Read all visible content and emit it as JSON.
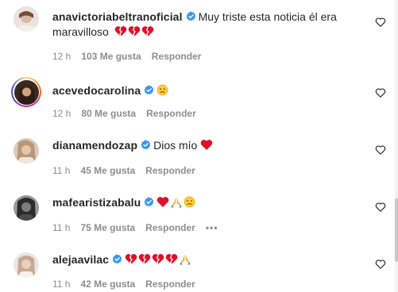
{
  "comments": [
    {
      "username": "anavictoriabeltranoficial",
      "verified": true,
      "text_line1": "Muy triste esta noticia él era",
      "text_line2": "maravilloso",
      "emojis": [
        "broken-heart",
        "broken-heart",
        "broken-heart"
      ],
      "time": "12 h",
      "likes": "103 Me gusta",
      "reply": "Responder"
    },
    {
      "username": "acevedocarolina",
      "verified": true,
      "text": "",
      "emojis": [
        "sad-face"
      ],
      "time": "12 h",
      "likes": "80 Me gusta",
      "reply": "Responder",
      "story_ring": true
    },
    {
      "username": "dianamendozap",
      "verified": true,
      "text": "Dios mío",
      "emojis": [
        "red-heart"
      ],
      "time": "11 h",
      "likes": "45 Me gusta",
      "reply": "Responder"
    },
    {
      "username": "mafearistizabalu",
      "verified": true,
      "text": "",
      "emojis": [
        "red-heart",
        "praying-hands",
        "sad-face"
      ],
      "time": "11 h",
      "likes": "75 Me gusta",
      "reply": "Responder",
      "more": "•••"
    },
    {
      "username": "alejaavilac",
      "verified": true,
      "text": "",
      "emojis": [
        "broken-heart",
        "broken-heart",
        "broken-heart",
        "broken-heart",
        "praying-hands"
      ],
      "time": "11 h",
      "likes": "42 Me gusta",
      "reply": "Responder"
    }
  ],
  "colors": {
    "verified_badge": "#3897f0",
    "meta_text": "#8e8e8e",
    "heart_red": "#e0102b"
  }
}
